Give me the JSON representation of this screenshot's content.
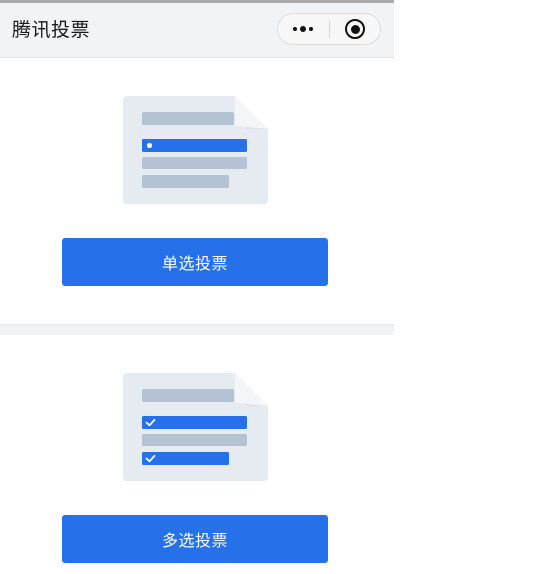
{
  "window": {
    "title": "腾讯投票"
  },
  "capsule": {
    "more_icon": "more-dots-icon",
    "close_icon": "target-close-icon"
  },
  "cards": [
    {
      "kind": "single",
      "illustration_icon": "single-choice-document-icon",
      "button_label": "单选投票"
    },
    {
      "kind": "multi",
      "illustration_icon": "multi-choice-document-icon",
      "button_label": "多选投票"
    }
  ],
  "colors": {
    "accent": "#2670ea",
    "nav_background": "#f2f3f5",
    "illustration_paper": "#e6ebf2",
    "illustration_line": "#b4c3d3",
    "divider_band": "#f1f2f4"
  },
  "watermark": ""
}
